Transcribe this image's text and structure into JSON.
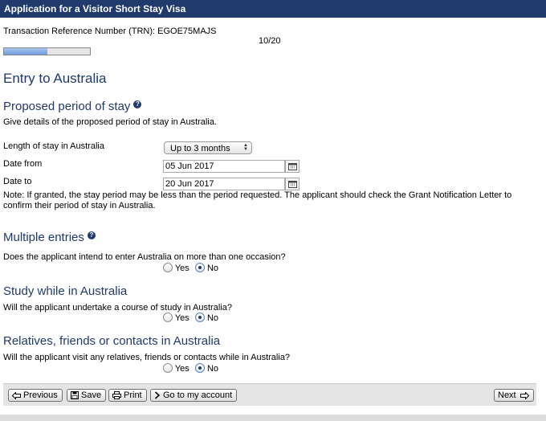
{
  "header": {
    "title": "Application for a Visitor Short Stay Visa"
  },
  "trn": {
    "text": "Transaction Reference Number (TRN): EGOE75MAJS"
  },
  "progress": {
    "page": "10/20",
    "fraction": 0.5
  },
  "page_title": "Entry to Australia",
  "stay": {
    "heading": "Proposed period of stay",
    "help_icon": "question-icon",
    "description": "Give details of the proposed period of stay in Australia.",
    "length_label": "Length of stay in Australia",
    "length_value": "Up to 3 months",
    "date_from_label": "Date from",
    "date_from_value": "05 Jun 2017",
    "date_to_label": "Date to",
    "date_to_value": "20 Jun 2017",
    "note": "Note: If granted, the stay period may be less than the period requested. The applicant should check the Grant Notification Letter to confirm their period of stay in Australia."
  },
  "multiple": {
    "heading": "Multiple entries",
    "question": "Does the applicant intend to enter Australia on more than one occasion?",
    "yes": "Yes",
    "no": "No",
    "selected": "No"
  },
  "study": {
    "heading": "Study while in Australia",
    "question": "Will the applicant undertake a course of study in Australia?",
    "yes": "Yes",
    "no": "No",
    "selected": "No"
  },
  "relatives": {
    "heading": "Relatives, friends or contacts in Australia",
    "question": "Will the applicant visit any relatives, friends or contacts while in Australia?",
    "yes": "Yes",
    "no": "No",
    "selected": "No"
  },
  "footer": {
    "previous": "Previous",
    "save": "Save",
    "print": "Print",
    "account": "Go to my account",
    "next": "Next"
  },
  "colors": {
    "brand": "#1f3a6b",
    "progress": "#6e9be0"
  }
}
